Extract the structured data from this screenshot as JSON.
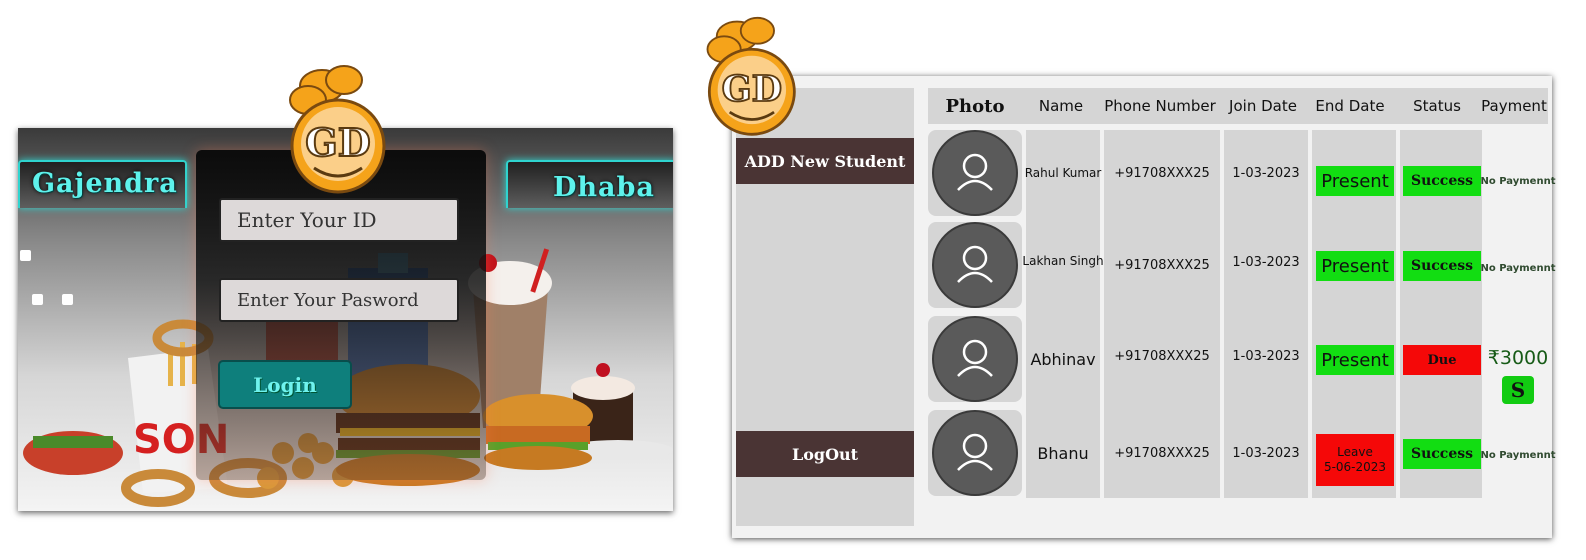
{
  "login": {
    "brand_left": "Gajendra",
    "brand_right": "Dhaba",
    "id_placeholder": "Enter Your ID",
    "password_placeholder": "Enter Your Pasword",
    "login_label": "Login"
  },
  "logo": {
    "text": "GD"
  },
  "dashboard": {
    "sidebar": {
      "add_label": "ADD New Student",
      "logout_label": "LogOut"
    },
    "columns": [
      "Photo",
      "Name",
      "Phone Number",
      "Join Date",
      "End Date",
      "Status",
      "Payment"
    ],
    "rows": [
      {
        "name": "Rahul Kumar",
        "phone": "+91708XXX25",
        "join": "1-03-2023",
        "end": "Present",
        "status": "Success",
        "payment": "No Paymennt"
      },
      {
        "name": "Lakhan Singh",
        "phone": "+91708XXX25",
        "join": "1-03-2023",
        "end": "Present",
        "status": "Success",
        "payment": "No Paymennt"
      },
      {
        "name": "Abhinav",
        "phone": "+91708XXX25",
        "join": "1-03-2023",
        "end": "Present",
        "status": "Due",
        "payment": "₹3000",
        "pay_button": "S"
      },
      {
        "name": "Bhanu",
        "phone": "+91708XXX25",
        "join": "1-03-2023",
        "end": "Leave",
        "end_date": "5-06-2023",
        "status": "Success",
        "payment": "No Paymennt"
      }
    ]
  },
  "colors": {
    "accent_teal": "#2fd4cf",
    "success_green": "#12dd12",
    "due_red": "#f50808",
    "sidebar_button": "#4a3434",
    "logo_orange": "#f5a31a"
  }
}
